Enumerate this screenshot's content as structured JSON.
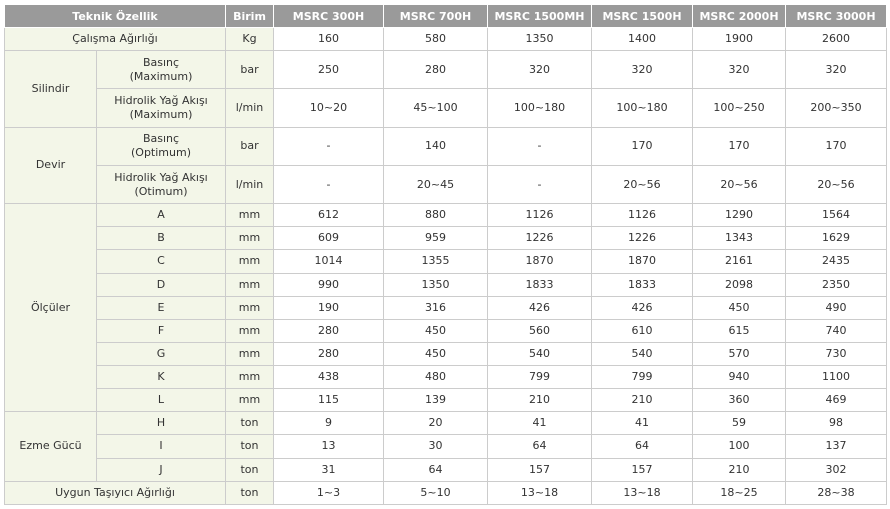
{
  "headers": [
    "Teknik Özellik",
    "Birim",
    "MSRC 300H",
    "MSRC 700H",
    "MSRC 1500MH",
    "MSRC 1500H",
    "MSRC 2000H",
    "MSRC 3000H"
  ],
  "groups": {
    "silindir": "Silindir",
    "devir": "Devir",
    "olculer": "Ölçüler",
    "ezme": "Ezme Gücü"
  },
  "rows": [
    {
      "label": "Çalışma Ağırlığı",
      "unit": "Kg",
      "values": [
        "160",
        "580",
        "1350",
        "1400",
        "1900",
        "2600"
      ]
    },
    {
      "label": "Basınç\n(Maximum)",
      "unit": "bar",
      "values": [
        "250",
        "280",
        "320",
        "320",
        "320",
        "320"
      ]
    },
    {
      "label": "Hidrolik Yağ Akışı\n(Maximum)",
      "unit": "l/min",
      "values": [
        "10~20",
        "45~100",
        "100~180",
        "100~180",
        "100~250",
        "200~350"
      ]
    },
    {
      "label": "Basınç\n(Optimum)",
      "unit": "bar",
      "values": [
        "-",
        "140",
        "-",
        "170",
        "170",
        "170"
      ]
    },
    {
      "label": "Hidrolik Yağ Akışı\n(Otimum)",
      "unit": "l/min",
      "values": [
        "-",
        "20~45",
        "-",
        "20~56",
        "20~56",
        "20~56"
      ]
    },
    {
      "label": "A",
      "unit": "mm",
      "values": [
        "612",
        "880",
        "1126",
        "1126",
        "1290",
        "1564"
      ]
    },
    {
      "label": "B",
      "unit": "mm",
      "values": [
        "609",
        "959",
        "1226",
        "1226",
        "1343",
        "1629"
      ]
    },
    {
      "label": "C",
      "unit": "mm",
      "values": [
        "1014",
        "1355",
        "1870",
        "1870",
        "2161",
        "2435"
      ]
    },
    {
      "label": "D",
      "unit": "mm",
      "values": [
        "990",
        "1350",
        "1833",
        "1833",
        "2098",
        "2350"
      ]
    },
    {
      "label": "E",
      "unit": "mm",
      "values": [
        "190",
        "316",
        "426",
        "426",
        "450",
        "490"
      ]
    },
    {
      "label": "F",
      "unit": "mm",
      "values": [
        "280",
        "450",
        "560",
        "610",
        "615",
        "740"
      ]
    },
    {
      "label": "G",
      "unit": "mm",
      "values": [
        "280",
        "450",
        "540",
        "540",
        "570",
        "730"
      ]
    },
    {
      "label": "K",
      "unit": "mm",
      "values": [
        "438",
        "480",
        "799",
        "799",
        "940",
        "1100"
      ]
    },
    {
      "label": "L",
      "unit": "mm",
      "values": [
        "115",
        "139",
        "210",
        "210",
        "360",
        "469"
      ]
    },
    {
      "label": "H",
      "unit": "ton",
      "values": [
        "9",
        "20",
        "41",
        "41",
        "59",
        "98"
      ]
    },
    {
      "label": "I",
      "unit": "ton",
      "values": [
        "13",
        "30",
        "64",
        "64",
        "100",
        "137"
      ]
    },
    {
      "label": "J",
      "unit": "ton",
      "values": [
        "31",
        "64",
        "157",
        "157",
        "210",
        "302"
      ]
    },
    {
      "label": "Uygun Taşıyıcı Ağırlığı",
      "unit": "ton",
      "values": [
        "1~3",
        "5~10",
        "13~18",
        "13~18",
        "18~25",
        "28~38"
      ]
    }
  ]
}
